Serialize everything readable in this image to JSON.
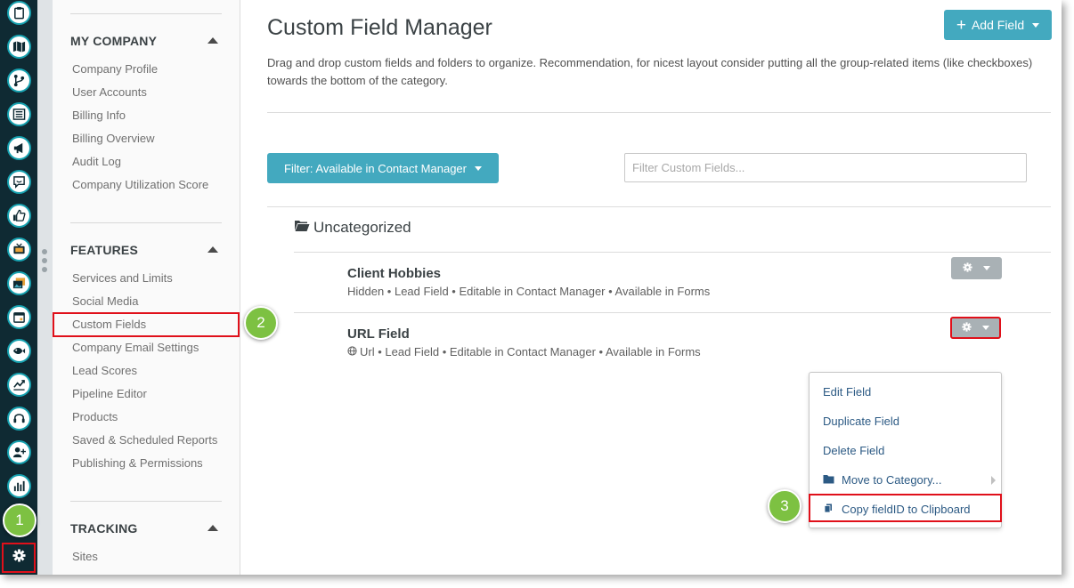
{
  "rail": {
    "icons": [
      "clipboard-icon",
      "map-icon",
      "branch-icon",
      "list-icon",
      "megaphone-icon",
      "chat-icon",
      "thumbs-up-icon",
      "tv-icon",
      "image-icon",
      "calendar-icon",
      "fish-icon",
      "chart-line-icon",
      "headset-icon",
      "user-add-icon",
      "bar-chart-icon"
    ],
    "settings_icon": "gear-icon"
  },
  "nav": {
    "sections": [
      {
        "title": "MY COMPANY",
        "items": [
          "Company Profile",
          "User Accounts",
          "Billing Info",
          "Billing Overview",
          "Audit Log",
          "Company Utilization Score"
        ]
      },
      {
        "title": "FEATURES",
        "items": [
          "Services and Limits",
          "Social Media",
          "Custom Fields",
          "Company Email Settings",
          "Lead Scores",
          "Pipeline Editor",
          "Products",
          "Saved & Scheduled Reports",
          "Publishing & Permissions"
        ]
      },
      {
        "title": "TRACKING",
        "items": [
          "Sites"
        ]
      }
    ],
    "selected_item": "Custom Fields"
  },
  "main": {
    "title": "Custom Field Manager",
    "add_button": "Add Field",
    "description": "Drag and drop custom fields and folders to organize. Recommendation, for nicest layout consider putting all the group-related items (like checkboxes) towards the bottom of the category.",
    "filter_button": "Filter: Available in Contact Manager",
    "filter_placeholder": "Filter Custom Fields...",
    "category": "Uncategorized",
    "fields": [
      {
        "name": "Client Hobbies",
        "meta": "Hidden • Lead Field • Editable in Contact Manager • Available in Forms"
      },
      {
        "name": "URL Field",
        "meta": "Url • Lead Field • Editable in Contact Manager • Available in Forms"
      }
    ]
  },
  "dropdown": {
    "items": [
      "Edit Field",
      "Duplicate Field",
      "Delete Field",
      "Move to Category...",
      "Copy fieldID to Clipboard"
    ]
  },
  "steps": [
    "1",
    "2",
    "3"
  ],
  "colors": {
    "accent": "#43a9bf",
    "rail": "#0f2a33",
    "highlight": "#e0101a",
    "step": "#7dc142",
    "link": "#2c5a84"
  }
}
